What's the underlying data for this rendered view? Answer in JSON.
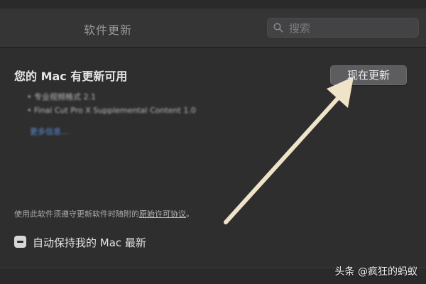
{
  "toolbar": {
    "title": "软件更新",
    "search_placeholder": "搜索"
  },
  "main": {
    "heading": "您的 Mac 有更新可用",
    "update_button": "现在更新",
    "updates": [
      "• 专业视频格式 2.1",
      "• Final Cut Pro X Supplemental Content 1.0"
    ],
    "more_info": "更多信息…",
    "license_prefix": "使用此软件须遵守更新软件时随附的",
    "license_link": "原始许可协议",
    "license_suffix": "。",
    "auto_update_label": "自动保持我的 Mac 最新",
    "auto_update_checked": "mixed"
  },
  "overlay": {
    "watermark": "头条 @疯狂的蚂蚁",
    "arrow_color": "#efe3c8"
  },
  "colors": {
    "background": "#2e2e2f",
    "button": "#5d5d60",
    "link": "#5a8fd8"
  }
}
